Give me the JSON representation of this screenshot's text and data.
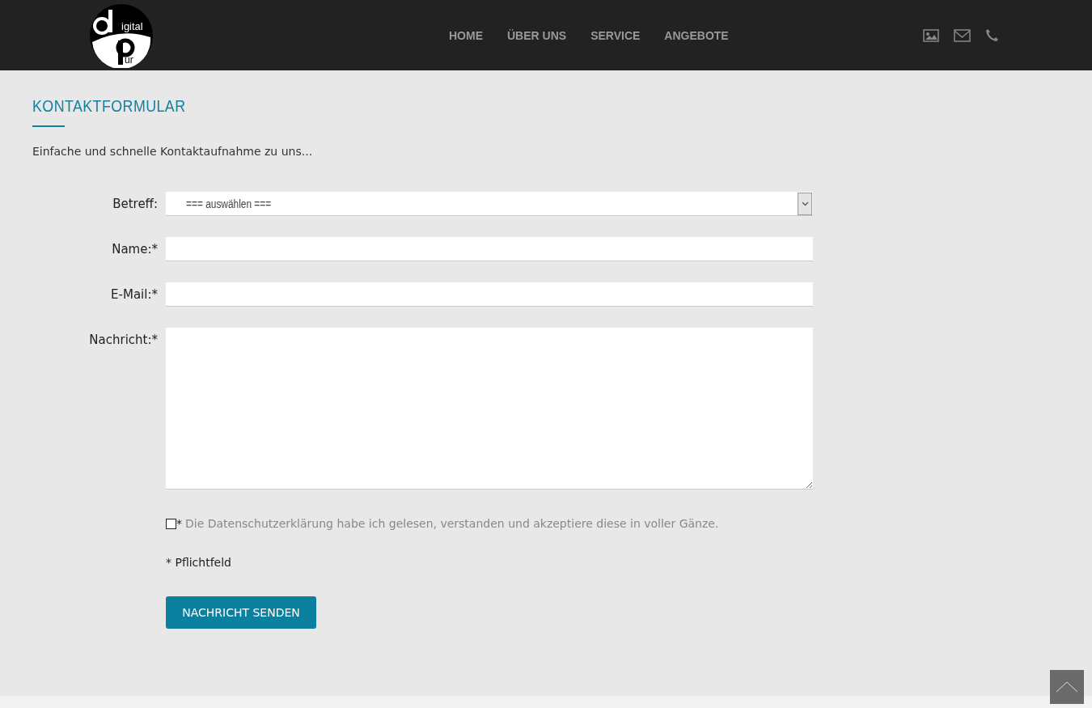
{
  "logo": {
    "top_text": "igital",
    "bottom_text": "ur"
  },
  "nav": [
    {
      "label": "HOME"
    },
    {
      "label": "ÜBER UNS"
    },
    {
      "label": "SERVICE"
    },
    {
      "label": "ANGEBOTE"
    }
  ],
  "header_icons": [
    {
      "kind": "image"
    },
    {
      "kind": "mail"
    },
    {
      "kind": "phone"
    }
  ],
  "page": {
    "title": "KONTAKTFORMULAR",
    "intro": "Einfache und schnelle Kontaktaufnahme zu uns..."
  },
  "form": {
    "fields": [
      {
        "kind": "select",
        "label": "Betreff:",
        "value": "=== auswählen ==="
      },
      {
        "kind": "text",
        "label": "Name:*"
      },
      {
        "kind": "text",
        "label": "E-Mail:*"
      },
      {
        "kind": "textarea",
        "label": "Nachricht:*"
      }
    ],
    "consent": {
      "checked": false,
      "mark": "*",
      "text": "Die Datenschutzerklärung habe ich gelesen, verstanden und akzeptiere diese in voller Gänze."
    },
    "required_note": "* Pflichtfeld",
    "submit": "NACHRICHT SENDEN"
  }
}
